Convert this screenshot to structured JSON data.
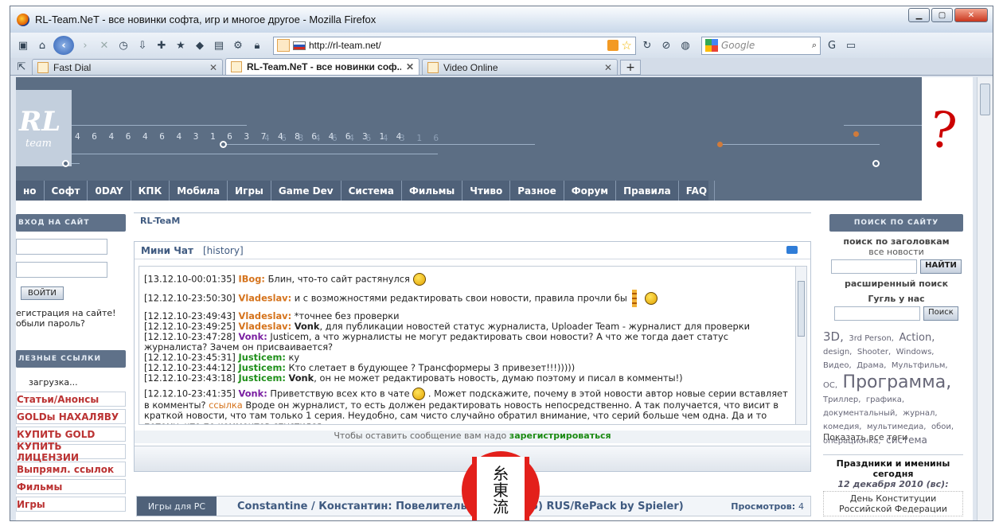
{
  "window": {
    "title": "RL-Team.NeT - все новинки софта, игр и многое другое - Mozilla Firefox"
  },
  "toolbar": {
    "url": "http://rl-team.net/",
    "search_placeholder": "Google"
  },
  "tabs": [
    {
      "label": "Fast Dial"
    },
    {
      "label": "RL-Team.NeT - все новинки соф..."
    },
    {
      "label": "Video Online"
    }
  ],
  "banner": {
    "logo_text": "RL",
    "logo_sub": "team",
    "digits": "4 6 4 6 4 6 4 3 1 6 3 7 4 8 6 4 6 3 1 4",
    "digits_fade": "4 6 8 4 6 4 6 4 3 1 6"
  },
  "menu": [
    "но",
    "Софт",
    "0DAY",
    "КПК",
    "Мобила",
    "Игры",
    "Game Dev",
    "Система",
    "Фильмы",
    "Чтиво",
    "Разное",
    "Форум",
    "Правила",
    "FAQ"
  ],
  "login": {
    "header": "ВХОД НА САЙТ",
    "button": "ВОЙТИ",
    "register": "егистрация на сайте!",
    "forgot": "обыли пароль?"
  },
  "links": {
    "header": "ЛЕЗНЫЕ ССЫЛКИ",
    "loading": "загрузка...",
    "items": [
      "Статьи/Анонсы",
      "GOLDы НАХАЛЯВУ",
      "КУПИТЬ GOLD",
      "КУПИТЬ ЛИЦЕНЗИИ",
      "Выпрямл. ссылок",
      "Фильмы",
      "Игры"
    ]
  },
  "main": {
    "title": "RL-TeaM"
  },
  "chat": {
    "title": "Мини Чат",
    "history": "[history]",
    "messages": [
      {
        "time": "[13.12.10-00:01:35]",
        "nick": "IBog:",
        "text": "Блин, что-то сайт растянулся"
      },
      {
        "time": "[12.12.10-23:50:30]",
        "nick": "Vladeslav:",
        "text": "и с возможностями редактировать свои новости, правила прочли бы"
      },
      {
        "time": "[12.12.10-23:49:43]",
        "nick": "Vladeslav:",
        "text": "*точнее без проверки"
      },
      {
        "time": "[12.12.10-23:49:25]",
        "nick": "Vladeslav:",
        "bold": "Vonk",
        "text": ", для публикации новостей статус журналиста, Uploader Team - журналист для проверки"
      },
      {
        "time": "[12.12.10-23:47:28]",
        "nick": "Vonk:",
        "text": "Justicem, а что журналисты не могут редактировать свои новости? А что же тогда дает статус журналиста? Зачем он присваивается?"
      },
      {
        "time": "[12.12.10-23:45:31]",
        "nick": "Justicem:",
        "text": "ку"
      },
      {
        "time": "[12.12.10-23:44:12]",
        "nick": "Justicem:",
        "text": "Кто слетает в будующее ? Трансформеры 3 привезет!!!)))))"
      },
      {
        "time": "[12.12.10-23:43:18]",
        "nick": "Justicem:",
        "bold": "Vonk",
        "text": ", он не может редактировать новость, думаю поэтому и писал в комменты!)"
      },
      {
        "time": "[12.12.10-23:41:35]",
        "nick": "Vonk:",
        "text": "Приветствую всех кто в чате",
        "text2": ". Может подскажите, почему в этой новости автор новые серии вставляет в комменты?",
        "link": "ссылка",
        "text3": "Вроде он журналист, то есть должен редактировать новость непосредственно. А так получается, что висит в краткой новости, что там только 1 серия. Неудобно, сам чисто случайно обратил внимание, что серий больше чем одна. Да и то потому, что по комментов спустился"
      }
    ],
    "register_prefix": "Чтобы оставить сообщение вам надо",
    "register_link": "зарегистрироваться"
  },
  "news": {
    "category": "Игры для PC",
    "title": "Constantine / Константин: Повелитель тьмы (2005) RUS/RePack by Spieler)",
    "views_label": "Просмотров:",
    "views": "4"
  },
  "stamp": {
    "chars": [
      "糸",
      "東",
      "流"
    ]
  },
  "sitesearch": {
    "header": "ПОИСК ПО САЙТУ",
    "by_titles": "поиск по заголовкам",
    "all_news": "все новости",
    "find_button": "НАЙТИ",
    "advanced": "расширенный поиск",
    "google_label": "Гугль у нас",
    "google_button": "Поиск"
  },
  "tags": {
    "items": [
      "3D,",
      "3rd Person,",
      "Action,",
      "design,",
      "Shooter,",
      "Windows,",
      "Видео,",
      "Драма,",
      "Мультфильм,",
      "OC,",
      "Программа,",
      "Триллер,",
      "графика,",
      "документальный,",
      "журнал,",
      "комедия,",
      "мультимедиа,",
      "обои,",
      "операционка,",
      "система"
    ],
    "show_all": "Показать все теги"
  },
  "holidays": {
    "title": "Праздники и именины сегодня",
    "date": "12 декабря 2010 (вс):",
    "item": "День Конституции Российской Федерации"
  }
}
